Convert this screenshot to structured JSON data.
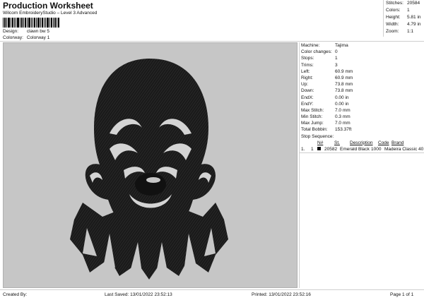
{
  "header": {
    "title": "Production Worksheet",
    "subtitle": "Wilcom EmbroideryStudio – Level 3 Advanced",
    "design_label": "Design:",
    "design_value": "clawn bw 5",
    "colorway_label": "Colorway:",
    "colorway_value": "Colorway 1"
  },
  "stats": [
    {
      "label": "Stitches:",
      "value": "20584"
    },
    {
      "label": "Colors:",
      "value": "1"
    },
    {
      "label": "Height:",
      "value": "5.81 in"
    },
    {
      "label": "Width:",
      "value": "4.79 in"
    },
    {
      "label": "Zoom:",
      "value": "1:1"
    }
  ],
  "properties": [
    {
      "label": "Machine:",
      "value": "Tajima"
    },
    {
      "label": "Color changes:",
      "value": "0"
    },
    {
      "label": "Stops:",
      "value": "1"
    },
    {
      "label": "Trims:",
      "value": "3"
    },
    {
      "label": "Left:",
      "value": "60.9 mm"
    },
    {
      "label": "Right:",
      "value": "60.9 mm"
    },
    {
      "label": "Up:",
      "value": "73.8 mm"
    },
    {
      "label": "Down:",
      "value": "73.8 mm"
    },
    {
      "label": "EndX:",
      "value": "0.00 in"
    },
    {
      "label": "EndY:",
      "value": "0.00 in"
    },
    {
      "label": "Max Stitch:",
      "value": "7.0 mm"
    },
    {
      "label": "Min Stitch:",
      "value": "0.3 mm"
    },
    {
      "label": "Max Jump:",
      "value": "7.0 mm"
    },
    {
      "label": "Total Bobbin:",
      "value": "153.37ft"
    }
  ],
  "stop_sequence": {
    "title": "Stop Sequence:",
    "headers": {
      "num": "N#",
      "st": "St.",
      "description": "Description",
      "code": "Code",
      "brand": "Brand"
    },
    "rows": [
      {
        "index": "1.",
        "num": "1",
        "color": "#111111",
        "st": "20582",
        "description": "Emerald Black",
        "code": "1000",
        "brand": "Madeira Classic 40"
      }
    ]
  },
  "footer": {
    "created_by": "Created By:",
    "last_saved": "Last Saved: 13/01/2022 23:52:13",
    "printed": "Printed: 13/01/2022 23:52:16",
    "page": "Page 1 of 1"
  },
  "colors": {
    "canvas": "#c6c6c6",
    "thread": "#1a1a1a",
    "highlight": "#d4d4d4"
  }
}
